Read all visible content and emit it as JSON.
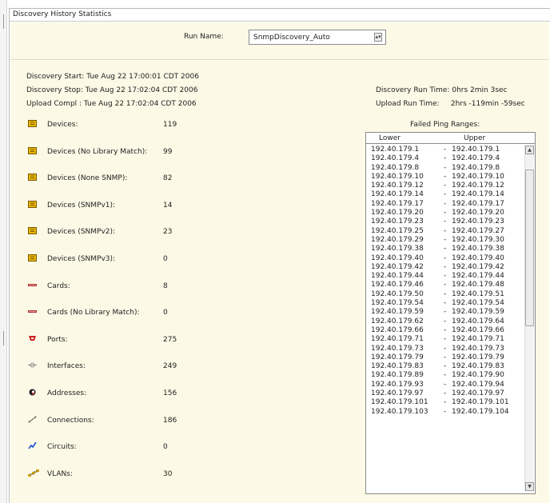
{
  "panel": {
    "title": "Discovery History Statistics"
  },
  "run": {
    "label": "Run Name:",
    "selected": "SnmpDiscovery_Auto"
  },
  "times": {
    "start": "Discovery Start: Tue Aug 22 17:00:01 CDT 2006",
    "stop": "Discovery Stop: Tue Aug 22 17:02:04 CDT 2006",
    "upload": "Upload Compl :  Tue Aug 22 17:02:04 CDT 2006",
    "run_time": "Discovery Run Time: 0hrs 2min 3sec",
    "upload_run_time": "Upload Run Time:     2hrs -119min -59sec"
  },
  "stats": [
    {
      "label": "Devices:",
      "value": "119",
      "icon": "device-icon"
    },
    {
      "label": "Devices (No Library Match):",
      "value": "99",
      "icon": "device-icon"
    },
    {
      "label": "Devices (None SNMP):",
      "value": "82",
      "icon": "device-icon"
    },
    {
      "label": "Devices (SNMPv1):",
      "value": "14",
      "icon": "device-icon"
    },
    {
      "label": "Devices (SNMPv2):",
      "value": "23",
      "icon": "device-icon"
    },
    {
      "label": "Devices (SNMPv3):",
      "value": "0",
      "icon": "device-icon"
    },
    {
      "label": "Cards:",
      "value": "8",
      "icon": "card-icon"
    },
    {
      "label": "Cards (No Library Match):",
      "value": "0",
      "icon": "card-icon"
    },
    {
      "label": "Ports:",
      "value": "275",
      "icon": "port-icon"
    },
    {
      "label": "Interfaces:",
      "value": "249",
      "icon": "interface-icon"
    },
    {
      "label": "Addresses:",
      "value": "156",
      "icon": "address-icon"
    },
    {
      "label": "Connections:",
      "value": "186",
      "icon": "connection-icon"
    },
    {
      "label": "Circuits:",
      "value": "0",
      "icon": "circuit-icon"
    },
    {
      "label": "VLANs:",
      "value": "30",
      "icon": "vlan-icon"
    }
  ],
  "failed_ping": {
    "title": "Failed Ping Ranges:",
    "col_lower": "Lower",
    "col_upper": "Upper",
    "rows": [
      {
        "lower": "192.40.179.1",
        "upper": "192.40.179.1"
      },
      {
        "lower": "192.40.179.4",
        "upper": "192.40.179.4"
      },
      {
        "lower": "192.40.179.8",
        "upper": "192.40.179.8"
      },
      {
        "lower": "192.40.179.10",
        "upper": "192.40.179.10"
      },
      {
        "lower": "192.40.179.12",
        "upper": "192.40.179.12"
      },
      {
        "lower": "192.40.179.14",
        "upper": "192.40.179.14"
      },
      {
        "lower": "192.40.179.17",
        "upper": "192.40.179.17"
      },
      {
        "lower": "192.40.179.20",
        "upper": "192.40.179.20"
      },
      {
        "lower": "192.40.179.23",
        "upper": "192.40.179.23"
      },
      {
        "lower": "192.40.179.25",
        "upper": "192.40.179.27"
      },
      {
        "lower": "192.40.179.29",
        "upper": "192.40.179.30"
      },
      {
        "lower": "192.40.179.38",
        "upper": "192.40.179.38"
      },
      {
        "lower": "192.40.179.40",
        "upper": "192.40.179.40"
      },
      {
        "lower": "192.40.179.42",
        "upper": "192.40.179.42"
      },
      {
        "lower": "192.40.179.44",
        "upper": "192.40.179.44"
      },
      {
        "lower": "192.40.179.46",
        "upper": "192.40.179.48"
      },
      {
        "lower": "192.40.179.50",
        "upper": "192.40.179.51"
      },
      {
        "lower": "192.40.179.54",
        "upper": "192.40.179.54"
      },
      {
        "lower": "192.40.179.59",
        "upper": "192.40.179.59"
      },
      {
        "lower": "192.40.179.62",
        "upper": "192.40.179.64"
      },
      {
        "lower": "192.40.179.66",
        "upper": "192.40.179.66"
      },
      {
        "lower": "192.40.179.71",
        "upper": "192.40.179.71"
      },
      {
        "lower": "192.40.179.73",
        "upper": "192.40.179.73"
      },
      {
        "lower": "192.40.179.79",
        "upper": "192.40.179.79"
      },
      {
        "lower": "192.40.179.83",
        "upper": "192.40.179.83"
      },
      {
        "lower": "192.40.179.89",
        "upper": "192.40.179.90"
      },
      {
        "lower": "192.40.179.93",
        "upper": "192.40.179.94"
      },
      {
        "lower": "192.40.179.97",
        "upper": "192.40.179.97"
      },
      {
        "lower": "192.40.179.101",
        "upper": "192.40.179.101"
      },
      {
        "lower": "192.40.179.103",
        "upper": "192.40.179.104"
      }
    ]
  },
  "colors": {
    "panel_bg": "#fcf9e6",
    "device_icon": "#e8b400",
    "card_icon": "#b03030",
    "port_icon": "#d02020",
    "circuit_icon": "#1a4fd6"
  }
}
